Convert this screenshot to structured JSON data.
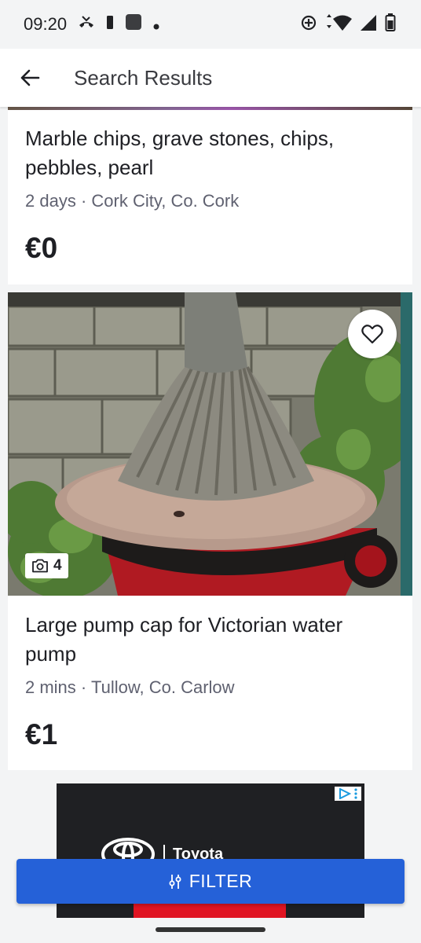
{
  "status_bar": {
    "time": "09:20"
  },
  "app_bar": {
    "title": "Search Results"
  },
  "listings": [
    {
      "title": "Marble chips, grave stones, chips, pebbles, pearl",
      "age": "2 days",
      "location": "Cork City, Co. Cork",
      "price": "€0"
    },
    {
      "title": "Large pump cap for Victorian water pump",
      "age": "2 mins",
      "location": "Tullow, Co. Carlow",
      "price": "€1",
      "photo_count": "4"
    }
  ],
  "meta_separator": "·",
  "ad": {
    "brand": "Toyota"
  },
  "filter_button": {
    "label": "FILTER"
  },
  "colors": {
    "accent": "#2561d8",
    "background": "#f3f4f5"
  }
}
